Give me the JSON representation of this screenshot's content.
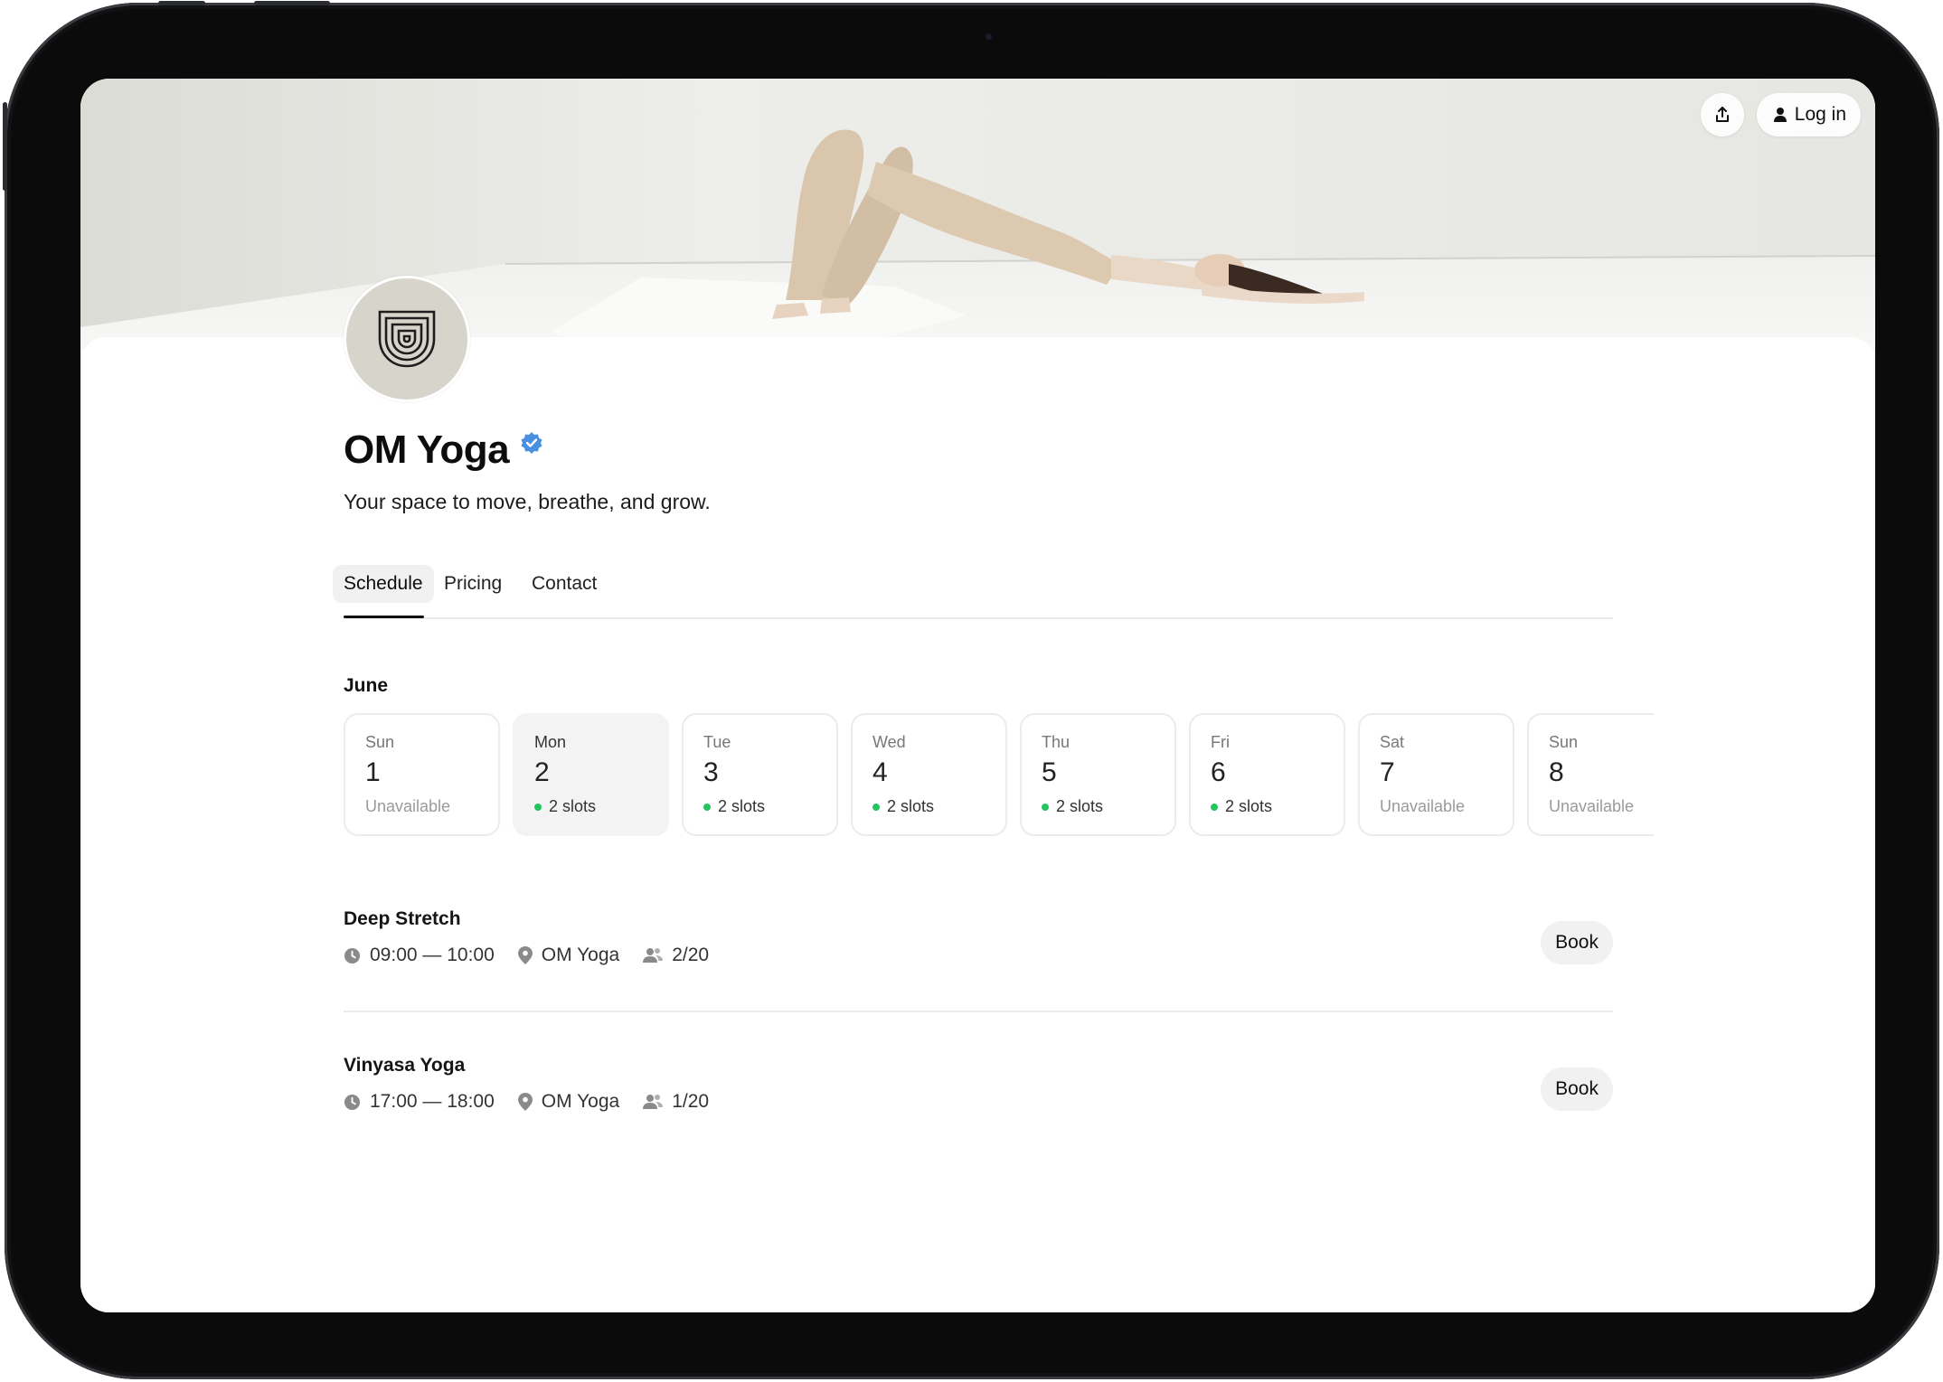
{
  "header": {
    "share_icon": "share-icon",
    "login_label": "Log in",
    "login_icon": "user-icon"
  },
  "studio": {
    "name": "OM Yoga",
    "verified_icon": "verified-badge-icon",
    "tagline": "Your space to move, breathe, and grow.",
    "logo_icon": "arch-logo-icon"
  },
  "tabs": [
    {
      "label": "Schedule",
      "active": true
    },
    {
      "label": "Pricing",
      "active": false
    },
    {
      "label": "Contact",
      "active": false
    }
  ],
  "schedule": {
    "month": "June",
    "days": [
      {
        "weekday": "Sun",
        "date": "1",
        "status": "Unavailable",
        "available": false,
        "selected": false
      },
      {
        "weekday": "Mon",
        "date": "2",
        "status": "2 slots",
        "available": true,
        "selected": true
      },
      {
        "weekday": "Tue",
        "date": "3",
        "status": "2 slots",
        "available": true,
        "selected": false
      },
      {
        "weekday": "Wed",
        "date": "4",
        "status": "2 slots",
        "available": true,
        "selected": false
      },
      {
        "weekday": "Thu",
        "date": "5",
        "status": "2 slots",
        "available": true,
        "selected": false
      },
      {
        "weekday": "Fri",
        "date": "6",
        "status": "2 slots",
        "available": true,
        "selected": false
      },
      {
        "weekday": "Sat",
        "date": "7",
        "status": "Unavailable",
        "available": false,
        "selected": false
      },
      {
        "weekday": "Sun",
        "date": "8",
        "status": "Unavailable",
        "available": false,
        "selected": false
      }
    ],
    "classes": [
      {
        "name": "Deep Stretch",
        "time": "09:00 — 10:00",
        "location": "OM Yoga",
        "capacity": "2/20",
        "book_label": "Book"
      },
      {
        "name": "Vinyasa Yoga",
        "time": "17:00 — 18:00",
        "location": "OM Yoga",
        "capacity": "1/20",
        "book_label": "Book"
      }
    ]
  },
  "colors": {
    "available_dot": "#22c55e",
    "verified": "#4a90e2",
    "avatar_bg": "#d7d5cb"
  }
}
